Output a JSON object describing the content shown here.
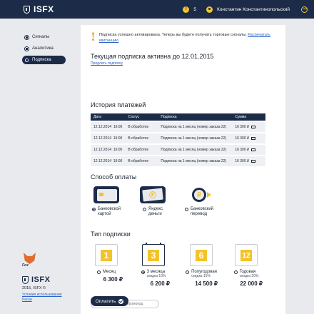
{
  "header": {
    "logo": "ISFX",
    "notifications": "5",
    "user": "Константин Константинопольский"
  },
  "sidebar": {
    "items": [
      {
        "label": "Сигналы"
      },
      {
        "label": "Аналитика"
      },
      {
        "label": "Подписка"
      }
    ],
    "mascot_tag": "Fox",
    "footer_logo": "ISFX",
    "copyright": "2015, ISFX ©",
    "links": [
      "Условия использования",
      "Риски"
    ]
  },
  "notice": {
    "text": "Подписка успешно активирована. Теперь вы будете получать торговые сигналы.",
    "link": "Распечатать квитанцию"
  },
  "subscription": {
    "active_title": "Текущая подписка активна до 12.01.2015",
    "extend_link": "Продлить подписку"
  },
  "history": {
    "title": "История платежей",
    "columns": [
      "Дата",
      "Статус",
      "Подписка",
      "Сумма"
    ],
    "rows": [
      {
        "date": "12.12.2014",
        "time": "16:00",
        "status": "В обработке",
        "sub": "Подписка на 1 месяц (номер заказа 22)",
        "sum": "16 300 ₽"
      },
      {
        "date": "12.12.2014",
        "time": "16:00",
        "status": "В обработке",
        "sub": "Подписка на 1 месяц (номер заказа 22)",
        "sum": "16 300 ₽"
      },
      {
        "date": "12.12.2014",
        "time": "16:00",
        "status": "В обработке",
        "sub": "Подписка на 1 месяц (номер заказа 22)",
        "sum": "16 300 ₽"
      },
      {
        "date": "12.12.2014",
        "time": "16:00",
        "status": "В обработке",
        "sub": "Подписка на 1 месяц (номер заказа 22)",
        "sum": "16 300 ₽"
      }
    ]
  },
  "payment": {
    "title": "Способ оплаты",
    "methods": [
      {
        "line1": "Банковской",
        "line2": "картой",
        "selected": true,
        "icon": "bank-card-icon"
      },
      {
        "line1": "Яндекс",
        "line2": "деньги",
        "selected": false,
        "icon": "yandex-money-icon"
      },
      {
        "line1": "Банковский",
        "line2": "перевод",
        "selected": false,
        "icon": "bank-transfer-icon"
      }
    ]
  },
  "plans": {
    "title": "Тип подписки",
    "items": [
      {
        "num": "1",
        "label": "Месяц",
        "discount": "",
        "price": "6 300 ₽",
        "selected": false
      },
      {
        "num": "3",
        "label": "3 месяца",
        "discount": "скидка 10%",
        "price": "6 200 ₽",
        "selected": true
      },
      {
        "num": "6",
        "label": "Полугодовая",
        "discount": "скидка 15%",
        "price": "14 500 ₽",
        "selected": false
      },
      {
        "num": "12",
        "label": "Годовая",
        "discount": "скидка 20%",
        "price": "22 000 ₽",
        "selected": false
      }
    ]
  },
  "promo": {
    "placeholder": "Ввести скидочный промокод"
  },
  "pay_button": "Оплатить",
  "colors": {
    "navy": "#1c2b48",
    "accent": "#f3c32c",
    "link": "#2a63c7"
  }
}
